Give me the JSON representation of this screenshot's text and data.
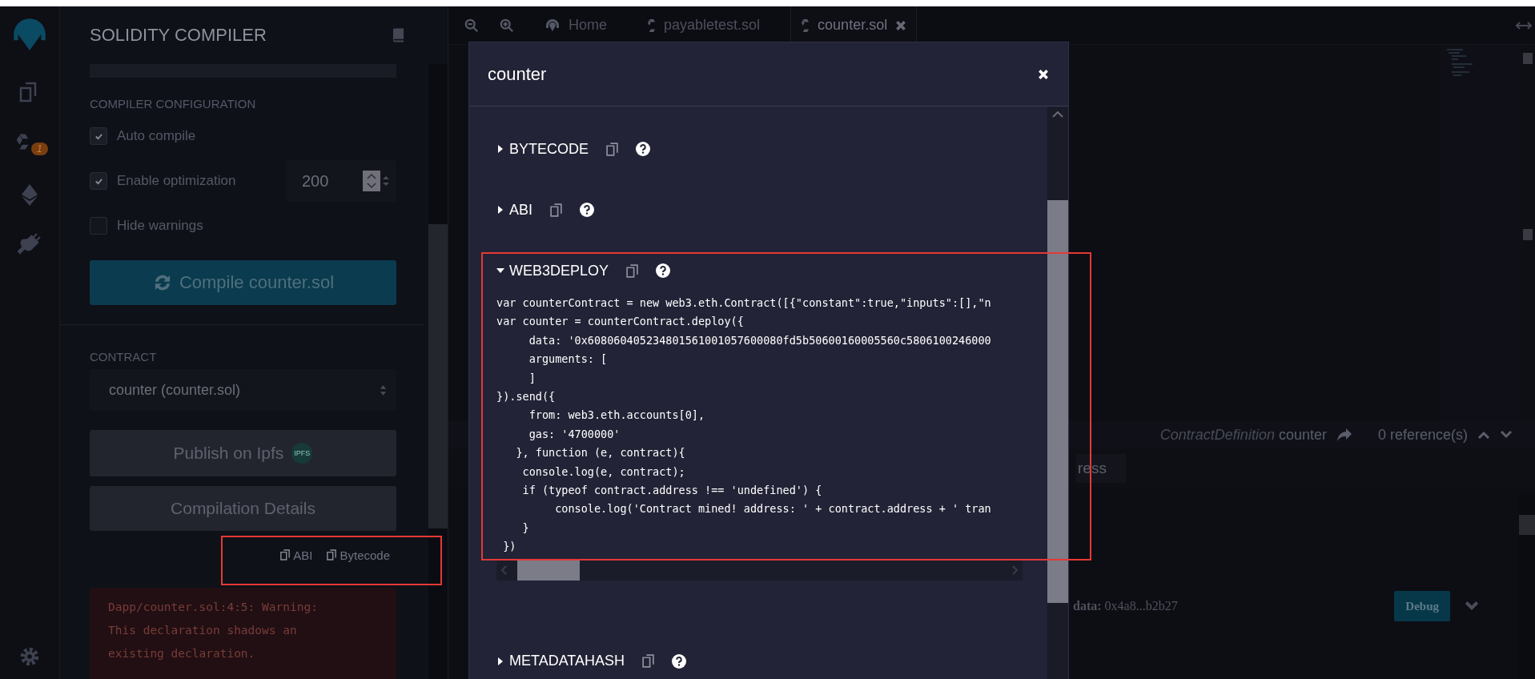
{
  "icon_bar": {
    "badge": "1"
  },
  "side_panel": {
    "title": "SOLIDITY COMPILER",
    "config_heading": "COMPILER CONFIGURATION",
    "options": [
      {
        "label": "Auto compile",
        "checked": true
      },
      {
        "label": "Enable optimization",
        "checked": true
      },
      {
        "label": "Hide warnings",
        "checked": false
      }
    ],
    "runs": "200",
    "compile_button": "Compile counter.sol",
    "contract_heading": "CONTRACT",
    "contract_select": "counter (counter.sol)",
    "publish_button": "Publish on Ipfs",
    "ipfs_badge": "IPFS",
    "details_button": "Compilation Details",
    "copy_links": [
      "ABI",
      "Bytecode"
    ],
    "warning": [
      "Dapp/counter.sol:4:5: Warning:",
      "This declaration shadows an",
      "existing declaration."
    ]
  },
  "tabs": [
    {
      "label": "Home",
      "kind": "home",
      "selected": false
    },
    {
      "label": "payabletest.sol",
      "kind": "file",
      "selected": false
    },
    {
      "label": "counter.sol",
      "kind": "file",
      "selected": true
    }
  ],
  "editor_footer": {
    "node_type": "ContractDefinition",
    "node_name": "counter",
    "references": "0 reference(s)"
  },
  "terminal": {
    "address_field": "ress",
    "log_label": "data:",
    "log_value": "0x4a8...b2b27",
    "debug_button": "Debug"
  },
  "modal": {
    "title": "counter",
    "sections": [
      {
        "label": "BYTECODE",
        "expanded": false
      },
      {
        "label": "ABI",
        "expanded": false
      },
      {
        "label": "WEB3DEPLOY",
        "expanded": true,
        "code": [
          "var counterContract = new web3.eth.Contract([{\"constant\":true,\"inputs\":[],\"n",
          "var counter = counterContract.deploy({",
          "     data: '0x608060405234801561001057600080fd5b50600160005560c5806100246000",
          "     arguments: [",
          "     ]",
          "}).send({",
          "     from: web3.eth.accounts[0],",
          "     gas: '4700000'",
          "   }, function (e, contract){",
          "    console.log(e, contract);",
          "    if (typeof contract.address !== 'undefined') {",
          "         console.log('Contract mined! address: ' + contract.address + ' tran",
          "    }",
          " })"
        ]
      },
      {
        "label": "METADATAHASH",
        "expanded": false
      }
    ]
  }
}
